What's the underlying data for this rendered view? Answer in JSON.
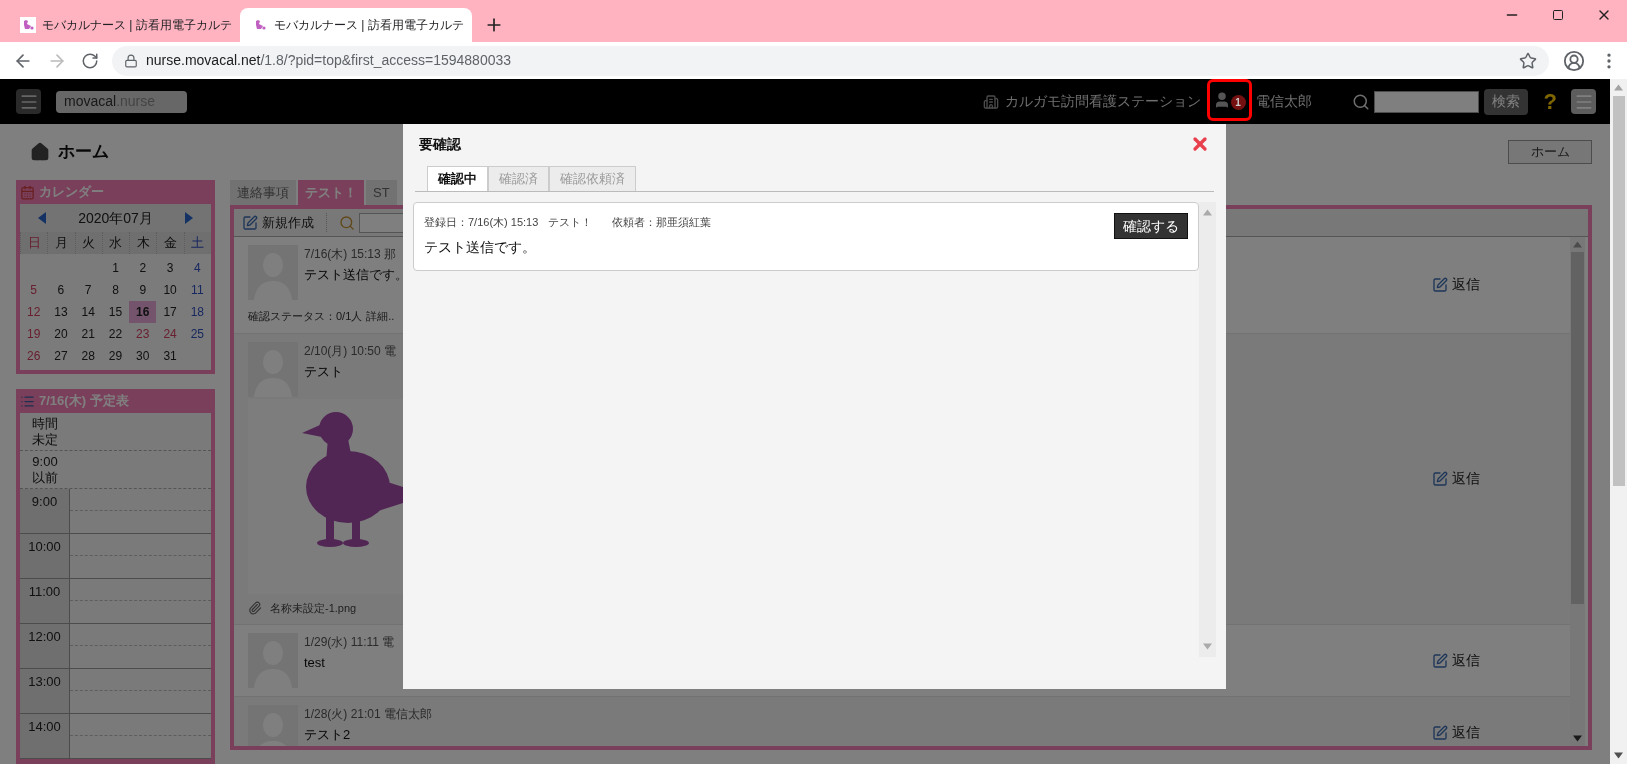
{
  "browser": {
    "tabs": [
      {
        "title": "モバカルナース | 訪看用電子カルテ",
        "selected": false
      },
      {
        "title": "モバカルナース | 訪看用電子カルテ",
        "selected": true
      }
    ],
    "url_host": "nurse.movacal.net",
    "url_path": "/1.8/?pid=top&first_access=1594880033"
  },
  "header": {
    "logo_main": "movacal",
    "logo_suffix": ".nurse",
    "station": "カルガモ訪問看護ステーション",
    "notification_count": "1",
    "user": "電信太郎",
    "search_button": "検索",
    "help": "?"
  },
  "page": {
    "title": "ホーム",
    "home_button": "ホーム"
  },
  "calendar": {
    "title": "カレンダー",
    "month": "2020年07月",
    "weekdays": [
      {
        "label": "日",
        "kind": "sunday"
      },
      {
        "label": "月",
        "kind": "weekday"
      },
      {
        "label": "火",
        "kind": "weekday"
      },
      {
        "label": "水",
        "kind": "weekday"
      },
      {
        "label": "木",
        "kind": "weekday"
      },
      {
        "label": "金",
        "kind": "weekday"
      },
      {
        "label": "土",
        "kind": "saturday"
      }
    ],
    "days": [
      {
        "kind": "blank",
        "selected": false
      },
      {
        "kind": "blank",
        "selected": false
      },
      {
        "kind": "blank",
        "selected": false
      },
      {
        "label": "1",
        "kind": "weekday",
        "selected": false
      },
      {
        "label": "2",
        "kind": "weekday",
        "selected": false
      },
      {
        "label": "3",
        "kind": "weekday",
        "selected": false
      },
      {
        "label": "4",
        "kind": "saturday",
        "selected": false
      },
      {
        "label": "5",
        "kind": "sunday",
        "selected": false
      },
      {
        "label": "6",
        "kind": "weekday",
        "selected": false
      },
      {
        "label": "7",
        "kind": "weekday",
        "selected": false
      },
      {
        "label": "8",
        "kind": "weekday",
        "selected": false
      },
      {
        "label": "9",
        "kind": "weekday",
        "selected": false
      },
      {
        "label": "10",
        "kind": "weekday",
        "selected": false
      },
      {
        "label": "11",
        "kind": "saturday",
        "selected": false
      },
      {
        "label": "12",
        "kind": "sunday",
        "selected": false
      },
      {
        "label": "13",
        "kind": "weekday",
        "selected": false
      },
      {
        "label": "14",
        "kind": "weekday",
        "selected": false
      },
      {
        "label": "15",
        "kind": "weekday",
        "selected": false
      },
      {
        "label": "16",
        "kind": "weekday",
        "selected": true
      },
      {
        "label": "17",
        "kind": "weekday",
        "selected": false
      },
      {
        "label": "18",
        "kind": "saturday",
        "selected": false
      },
      {
        "label": "19",
        "kind": "sunday",
        "selected": false
      },
      {
        "label": "20",
        "kind": "weekday",
        "selected": false
      },
      {
        "label": "21",
        "kind": "weekday",
        "selected": false
      },
      {
        "label": "22",
        "kind": "weekday",
        "selected": false
      },
      {
        "label": "23",
        "kind": "holiday",
        "selected": false
      },
      {
        "label": "24",
        "kind": "holiday",
        "selected": false
      },
      {
        "label": "25",
        "kind": "saturday",
        "selected": false
      },
      {
        "label": "26",
        "kind": "sunday",
        "selected": false
      },
      {
        "label": "27",
        "kind": "weekday",
        "selected": false
      },
      {
        "label": "28",
        "kind": "weekday",
        "selected": false
      },
      {
        "label": "29",
        "kind": "weekday",
        "selected": false
      },
      {
        "label": "30",
        "kind": "weekday",
        "selected": false
      },
      {
        "label": "31",
        "kind": "weekday",
        "selected": false
      }
    ]
  },
  "schedule": {
    "title": "7/16(木) 予定表",
    "untimed_rows": [
      {
        "lines": [
          "時間",
          "未定"
        ]
      },
      {
        "lines": [
          "9:00",
          "以前"
        ]
      }
    ],
    "hours": [
      "9:00",
      "10:00",
      "11:00",
      "12:00",
      "13:00",
      "14:00"
    ]
  },
  "board": {
    "tabs": [
      {
        "label": "連絡事項",
        "selected": false
      },
      {
        "label": "テスト！",
        "selected": true
      },
      {
        "label": "ST",
        "selected": false
      }
    ],
    "new_button": "新規作成",
    "messages": [
      {
        "meta": "7/16(木) 15:13 那",
        "body": "テスト送信です。",
        "status": "確認ステータス：0/1人",
        "status_link": "詳細..",
        "reply": "返信"
      },
      {
        "meta": "2/10(月) 10:50 電",
        "body": "テスト",
        "attachment_name": "名称未設定-1.png",
        "reply": "返信"
      },
      {
        "meta": "1/29(水) 11:11 電",
        "body": "test",
        "reply": "返信"
      },
      {
        "meta": "1/28(火) 21:01 電信太郎",
        "body": "テスト2",
        "reply": "返信"
      }
    ]
  },
  "modal": {
    "title": "要確認",
    "tabs": [
      {
        "label": "確認中",
        "selected": true
      },
      {
        "label": "確認済",
        "selected": false
      },
      {
        "label": "確認依頼済",
        "selected": false
      }
    ],
    "items": [
      {
        "registered": "登録日：7/16(木) 15:13",
        "category": "テスト！",
        "requester": "依頼者：那亜須紅葉",
        "body": "テスト送信です。",
        "confirm_button": "確認する"
      }
    ]
  }
}
